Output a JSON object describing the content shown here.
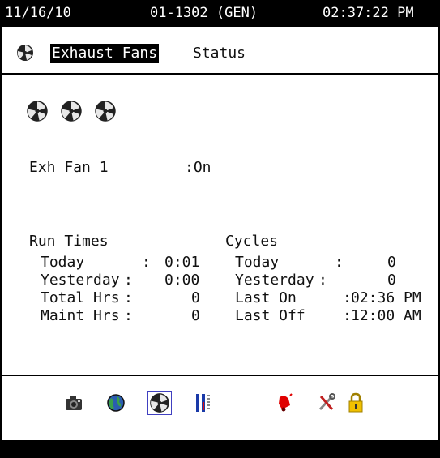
{
  "topbar": {
    "date": "11/16/10",
    "controller": "01-1302 (GEN)",
    "time": "02:37:22 PM"
  },
  "title": {
    "highlight": "Exhaust Fans",
    "rest": "Status",
    "icon": "fan-icon"
  },
  "fans": [
    "fan-icon",
    "fan-icon",
    "fan-icon"
  ],
  "fan1": {
    "label": "Exh Fan 1",
    "value": ":On"
  },
  "run_times": {
    "header": "Run Times",
    "rows": [
      {
        "label": "Today",
        "sep": ":",
        "value": "0:01"
      },
      {
        "label": "Yesterday",
        "sep": ":",
        "value": "0:00"
      },
      {
        "label": "Total Hrs",
        "sep": ":",
        "value": "0"
      },
      {
        "label": "Maint Hrs",
        "sep": ":",
        "value": "0"
      }
    ]
  },
  "cycles": {
    "header": "Cycles",
    "rows": [
      {
        "label": "Today",
        "sep": ":",
        "value": "0"
      },
      {
        "label": "Yesterday",
        "sep": ":",
        "value": "0"
      },
      {
        "label": "Last On",
        "sep": ":",
        "value": "02:36 PM"
      },
      {
        "label": "Last Off",
        "sep": ":",
        "value": "12:00 AM"
      }
    ]
  },
  "toolbar": [
    {
      "name": "camera-icon"
    },
    {
      "name": "globe-icon"
    },
    {
      "name": "fan-icon",
      "active": true
    },
    {
      "name": "thermometer-icon"
    },
    {
      "name": "alarm-bell-icon"
    },
    {
      "name": "tools-icon"
    },
    {
      "name": "lock-icon"
    }
  ],
  "colors": {
    "background": "#ffffff",
    "bar": "#000000",
    "text": "#111111",
    "bell": "#e00000",
    "lock": "#f0c000",
    "active_outline": "#4040c0"
  }
}
